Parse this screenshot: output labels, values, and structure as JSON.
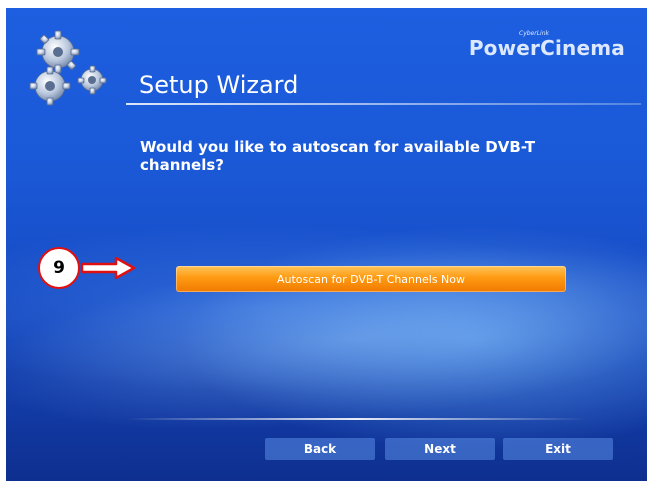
{
  "app": {
    "brand_small": "CyberLink",
    "brand": "PowerCinema"
  },
  "wizard": {
    "title": "Setup Wizard",
    "question": "Would you like to autoscan for available DVB-T channels?",
    "autoscan_label": "Autoscan for DVB-T Channels Now"
  },
  "annotation": {
    "step_number": "9"
  },
  "nav": {
    "back_label": "Back",
    "next_label": "Next",
    "exit_label": "Exit"
  },
  "colors": {
    "background": "#1a58d6",
    "accent_button": "#ff9a12",
    "marker_border": "#e01010"
  },
  "icons": {
    "wizard_icon": "gears-icon",
    "pointer": "arrow-right-icon"
  }
}
